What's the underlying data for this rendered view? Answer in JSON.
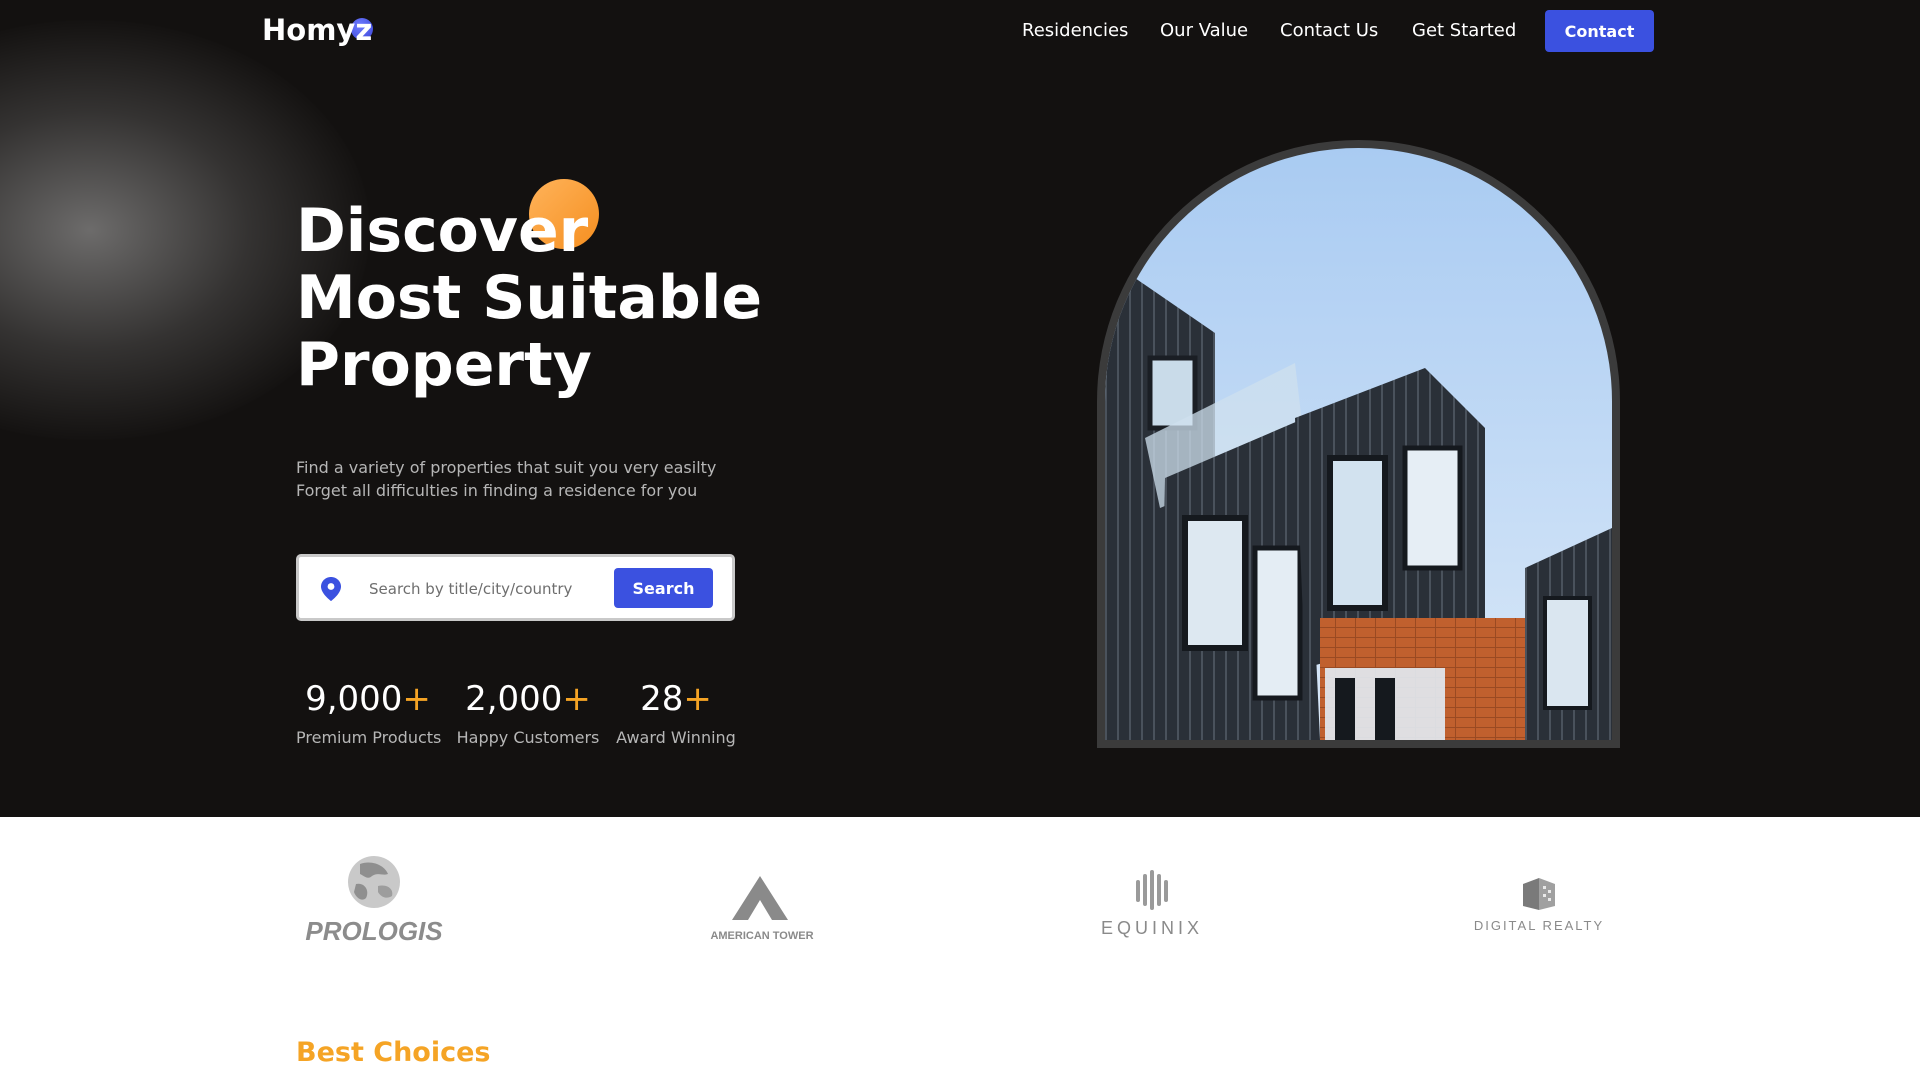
{
  "brand": {
    "name": "Homyz"
  },
  "nav": {
    "links": [
      "Residencies",
      "Our Value",
      "Contact Us",
      "Get Started"
    ],
    "cta_label": "Contact"
  },
  "hero": {
    "headline": [
      "Discover",
      "Most Suitable",
      "Property"
    ],
    "subtext": [
      "Find a variety of properties that suit you very easilty",
      "Forget all difficulties in finding a residence for you"
    ],
    "search": {
      "placeholder": "Search by title/city/country",
      "button_label": "Search",
      "icon": "location-pin-icon"
    },
    "stats": [
      {
        "value": "9,000",
        "suffix": "+",
        "label": "Premium Products"
      },
      {
        "value": "2,000",
        "suffix": "+",
        "label": "Happy Customers"
      },
      {
        "value": "28",
        "suffix": "+",
        "label": "Award Winning"
      }
    ]
  },
  "partners": [
    {
      "name": "PROLOGIS",
      "icon": "prologis-logo"
    },
    {
      "name": "AMERICAN TOWER",
      "icon": "american-tower-logo"
    },
    {
      "name": "EQUINIX",
      "icon": "equinix-logo"
    },
    {
      "name": "DIGITAL REALTY",
      "icon": "digital-realty-logo"
    }
  ],
  "section": {
    "title": "Best Choices"
  },
  "colors": {
    "accent_blue": "#3b51e0",
    "accent_orange": "#f5a425",
    "hero_bg": "#131110"
  }
}
